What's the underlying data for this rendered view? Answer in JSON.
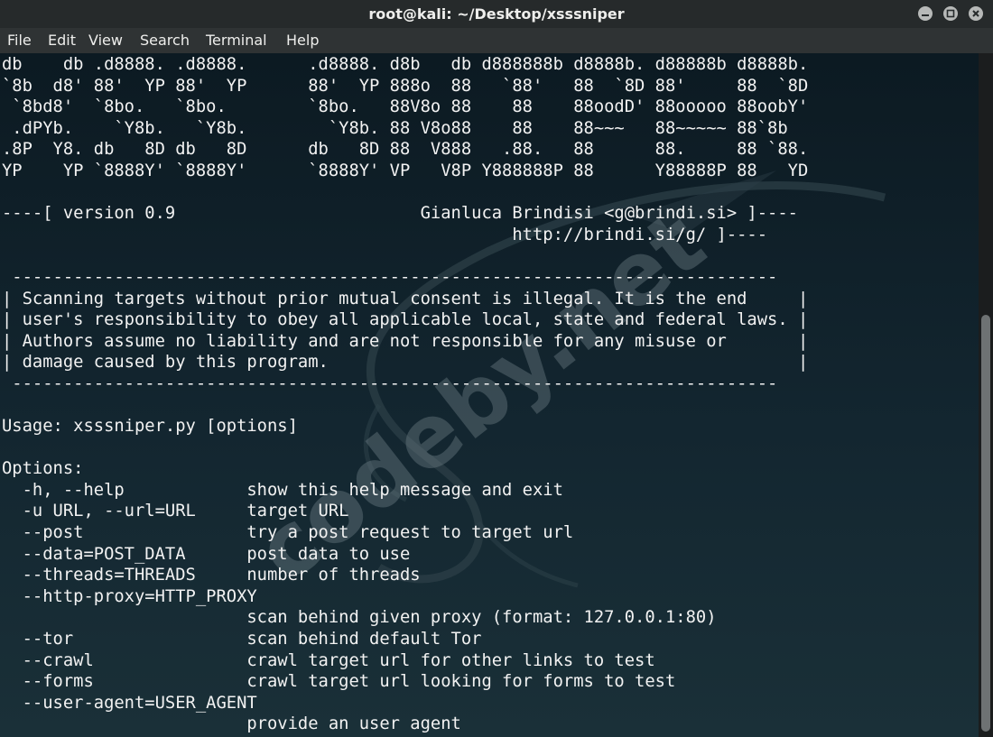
{
  "window": {
    "title": "root@kali: ~/Desktop/xsssniper"
  },
  "menu": [
    "File",
    "Edit",
    "View",
    "Search",
    "Terminal",
    "Help"
  ],
  "watermark": "codeby.net",
  "terminal": {
    "lines": [
      "db    db .d8888. .d8888.      .d8888. d8b   db d888888b d8888b. d88888b d8888b.",
      "`8b  d8' 88'  YP 88'  YP      88'  YP 888o  88   `88'   88  `8D 88'     88  `8D",
      " `8bd8'  `8bo.   `8bo.        `8bo.   88V8o 88    88    88oodD' 88ooooo 88oobY'",
      " .dPYb.    `Y8b.   `Y8b.        `Y8b. 88 V8o88    88    88~~~   88~~~~~ 88`8b",
      ".8P  Y8. db   8D db   8D      db   8D 88  V888   .88.   88      88.     88 `88.",
      "YP    YP `8888Y' `8888Y'      `8888Y' VP   V8P Y888888P 88      Y88888P 88   YD",
      "",
      "----[ version 0.9                        Gianluca Brindisi <g@brindi.si> ]----",
      "                                                  http://brindi.si/g/ ]----",
      "",
      " ---------------------------------------------------------------------------",
      "| Scanning targets without prior mutual consent is illegal. It is the end     |",
      "| user's responsibility to obey all applicable local, state and federal laws. |",
      "| Authors assume no liability and are not responsible for any misuse or       |",
      "| damage caused by this program.                                              |",
      " ---------------------------------------------------------------------------",
      "",
      "Usage: xsssniper.py [options]",
      "",
      "Options:",
      "  -h, --help            show this help message and exit",
      "  -u URL, --url=URL     target URL",
      "  --post                try a post request to target url",
      "  --data=POST_DATA      post data to use",
      "  --threads=THREADS     number of threads",
      "  --http-proxy=HTTP_PROXY",
      "                        scan behind given proxy (format: 127.0.0.1:80)",
      "  --tor                 scan behind default Tor",
      "  --crawl               crawl target url for other links to test",
      "  --forms               crawl target url looking for forms to test",
      "  --user-agent=USER_AGENT",
      "                        provide an user agent"
    ]
  }
}
